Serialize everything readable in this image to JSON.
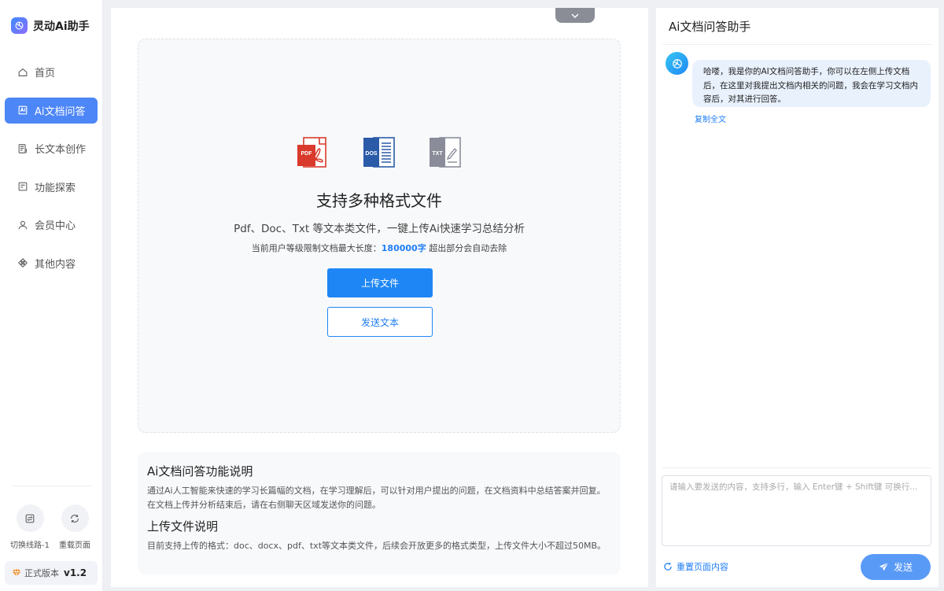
{
  "brand": {
    "title": "灵动Ai助手",
    "icon": "openai-logo-icon"
  },
  "nav": [
    {
      "label": "首页",
      "icon": "home-icon",
      "active": false
    },
    {
      "label": "Ai文档问答",
      "icon": "document-ai-icon",
      "active": true
    },
    {
      "label": "长文本创作",
      "icon": "long-text-icon",
      "active": false
    },
    {
      "label": "功能探索",
      "icon": "explore-icon",
      "active": false
    },
    {
      "label": "会员中心",
      "icon": "user-icon",
      "active": false
    },
    {
      "label": "其他内容",
      "icon": "other-icon",
      "active": false
    }
  ],
  "side_tools": {
    "switch_route": "切换线路-1",
    "reload_page": "重载页面"
  },
  "version": {
    "label": "正式版本",
    "number": "v1.2",
    "icon": "diamond-icon"
  },
  "upload": {
    "file_types": [
      "PDF",
      "DOS",
      "TXT"
    ],
    "title": "支持多种格式文件",
    "subtitle": "Pdf、Doc、Txt 等文本类文件，一键上传Ai快速学习总结分析",
    "limit_prefix": "当前用户等级限制文档最大长度：",
    "limit_value": "180000字",
    "limit_suffix": " 超出部分会自动去除",
    "upload_button": "上传文件",
    "send_text_button": "发送文本"
  },
  "info": {
    "title1": "Ai文档问答功能说明",
    "body1": "通过Ai人工智能来快速的学习长篇幅的文档，在学习理解后，可以针对用户提出的问题，在文档资料中总结答案并回复。在文档上传并分析结束后，请在右侧聊天区域发送你的问题。",
    "title2": "上传文件说明",
    "body2": "目前支持上传的格式：doc、docx、pdf、txt等文本类文件，后续会开放更多的格式类型，上传文件大小不超过50MB。"
  },
  "chat": {
    "title": "Ai文档问答助手",
    "welcome": "哈喽，我是你的AI文档问答助手，你可以在左侧上传文档后，在这里对我提出文档内相关的问题，我会在学习文档内容后，对其进行回答。",
    "copy_label": "复制全文",
    "input_placeholder": "请输入要发送的内容，支持多行，输入 Enter键 + Shift键 可换行...",
    "reset_label": "重置页面内容",
    "send_label": "发送"
  },
  "colors": {
    "accent": "#1f87f5",
    "nav_active": "#4d86f7",
    "pdf_red": "#d93a2b",
    "doc_blue": "#2b5aa8",
    "txt_gray": "#8a8d99"
  }
}
